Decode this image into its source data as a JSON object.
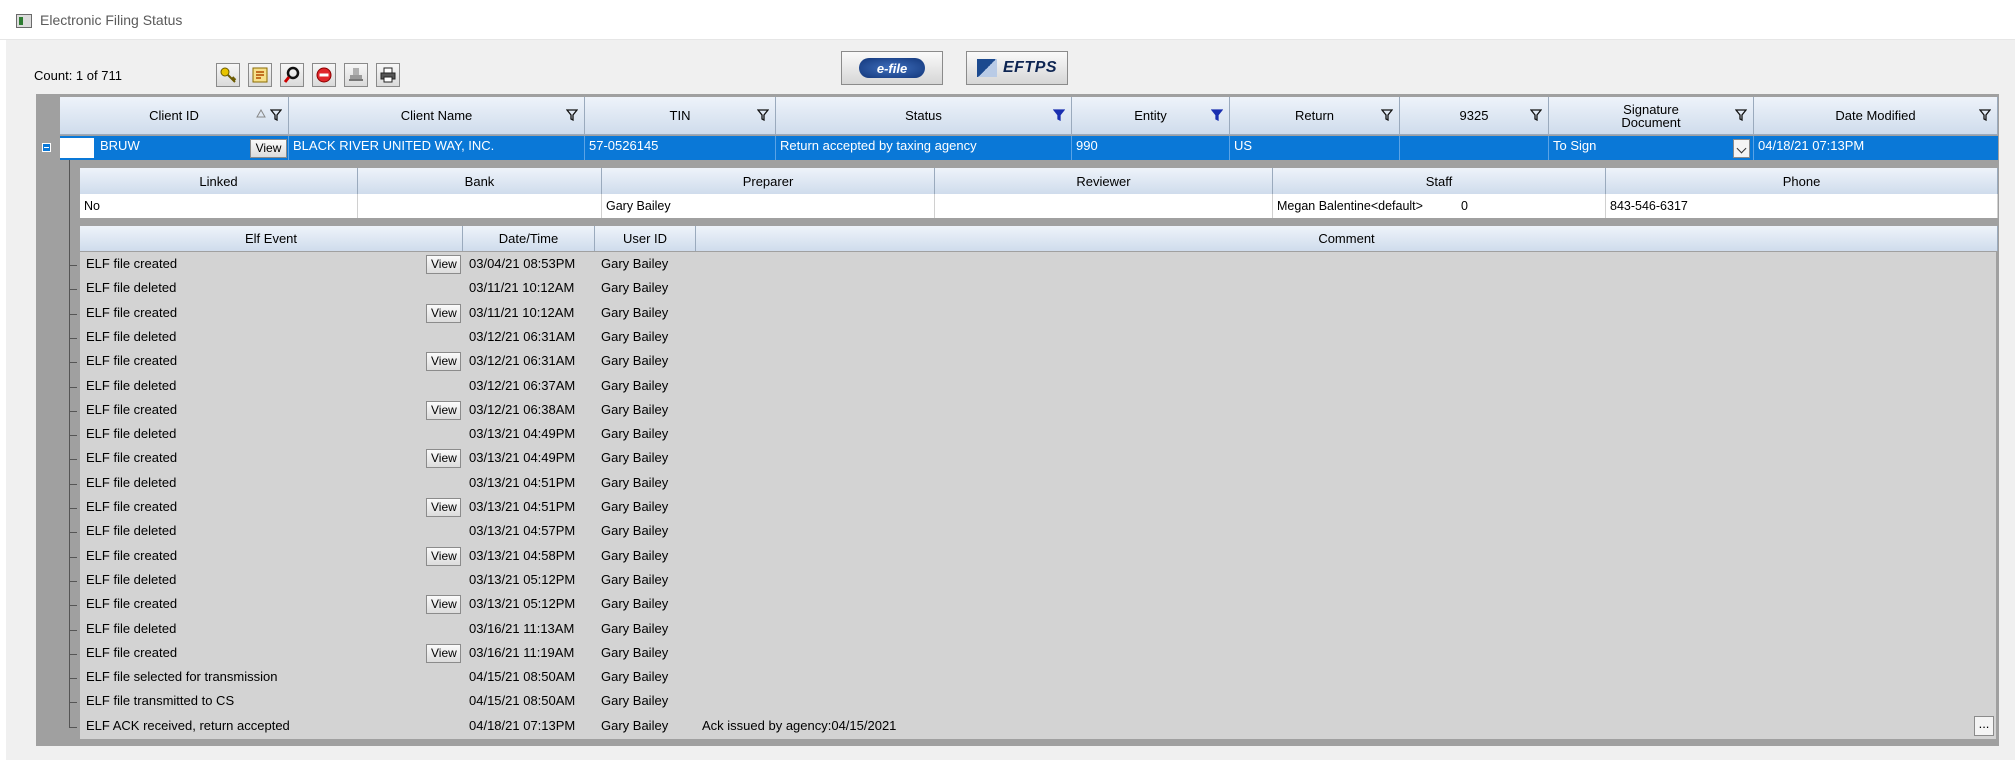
{
  "window": {
    "title": "Electronic Filing Status"
  },
  "toolbar": {
    "count": "Count: 1 of 711",
    "buttons": [
      "key-icon",
      "report-icon",
      "search-icon",
      "stop-icon",
      "stamp-icon",
      "print-icon"
    ],
    "efile_label": "e-file",
    "eftps_label": "EFTPS"
  },
  "main_headers": [
    "Client ID",
    "Client Name",
    "TIN",
    "Status",
    "Entity",
    "Return",
    "9325",
    "Signature Document",
    "Date Modified"
  ],
  "main_row": {
    "client_id": "BRUW",
    "view": "View",
    "client_name": "BLACK RIVER UNITED WAY, INC.",
    "tin": "57-0526145",
    "status": "Return accepted by taxing agency",
    "entity": "990",
    "return": "US",
    "f9325": "",
    "signature": "To Sign",
    "date_modified": "04/18/21 07:13PM"
  },
  "detail_headers": [
    "Linked",
    "Bank",
    "Preparer",
    "Reviewer",
    "Staff",
    "Phone"
  ],
  "detail_row": {
    "linked": "No",
    "bank": "",
    "preparer": "Gary Bailey",
    "reviewer": "",
    "staff": "Megan Balentine<default>",
    "staff_count": "0",
    "phone": "843-546-6317"
  },
  "event_headers": [
    "Elf Event",
    "Date/Time",
    "User ID",
    "Comment"
  ],
  "events": [
    {
      "event": "ELF file created",
      "view": "View",
      "datetime": "03/04/21 08:53PM",
      "user": "Gary Bailey",
      "comment": ""
    },
    {
      "event": "ELF file deleted",
      "view": "",
      "datetime": "03/11/21 10:12AM",
      "user": "Gary Bailey",
      "comment": ""
    },
    {
      "event": "ELF file created",
      "view": "View",
      "datetime": "03/11/21 10:12AM",
      "user": "Gary Bailey",
      "comment": ""
    },
    {
      "event": "ELF file deleted",
      "view": "",
      "datetime": "03/12/21 06:31AM",
      "user": "Gary Bailey",
      "comment": ""
    },
    {
      "event": "ELF file created",
      "view": "View",
      "datetime": "03/12/21 06:31AM",
      "user": "Gary Bailey",
      "comment": ""
    },
    {
      "event": "ELF file deleted",
      "view": "",
      "datetime": "03/12/21 06:37AM",
      "user": "Gary Bailey",
      "comment": ""
    },
    {
      "event": "ELF file created",
      "view": "View",
      "datetime": "03/12/21 06:38AM",
      "user": "Gary Bailey",
      "comment": ""
    },
    {
      "event": "ELF file deleted",
      "view": "",
      "datetime": "03/13/21 04:49PM",
      "user": "Gary Bailey",
      "comment": ""
    },
    {
      "event": "ELF file created",
      "view": "View",
      "datetime": "03/13/21 04:49PM",
      "user": "Gary Bailey",
      "comment": ""
    },
    {
      "event": "ELF file deleted",
      "view": "",
      "datetime": "03/13/21 04:51PM",
      "user": "Gary Bailey",
      "comment": ""
    },
    {
      "event": "ELF file created",
      "view": "View",
      "datetime": "03/13/21 04:51PM",
      "user": "Gary Bailey",
      "comment": ""
    },
    {
      "event": "ELF file deleted",
      "view": "",
      "datetime": "03/13/21 04:57PM",
      "user": "Gary Bailey",
      "comment": ""
    },
    {
      "event": "ELF file created",
      "view": "View",
      "datetime": "03/13/21 04:58PM",
      "user": "Gary Bailey",
      "comment": ""
    },
    {
      "event": "ELF file deleted",
      "view": "",
      "datetime": "03/13/21 05:12PM",
      "user": "Gary Bailey",
      "comment": ""
    },
    {
      "event": "ELF file created",
      "view": "View",
      "datetime": "03/13/21 05:12PM",
      "user": "Gary Bailey",
      "comment": ""
    },
    {
      "event": "ELF file deleted",
      "view": "",
      "datetime": "03/16/21 11:13AM",
      "user": "Gary Bailey",
      "comment": ""
    },
    {
      "event": "ELF file created",
      "view": "View",
      "datetime": "03/16/21 11:19AM",
      "user": "Gary Bailey",
      "comment": ""
    },
    {
      "event": "ELF file selected for transmission",
      "view": "",
      "datetime": "04/15/21 08:50AM",
      "user": "Gary Bailey",
      "comment": ""
    },
    {
      "event": "ELF file transmitted to CS",
      "view": "",
      "datetime": "04/15/21 08:50AM",
      "user": "Gary Bailey",
      "comment": ""
    },
    {
      "event": "ELF ACK received, return accepted",
      "view": "",
      "datetime": "04/18/21 07:13PM",
      "user": "Gary Bailey",
      "comment": "Ack issued by agency:04/15/2021"
    }
  ],
  "more_button": "..."
}
